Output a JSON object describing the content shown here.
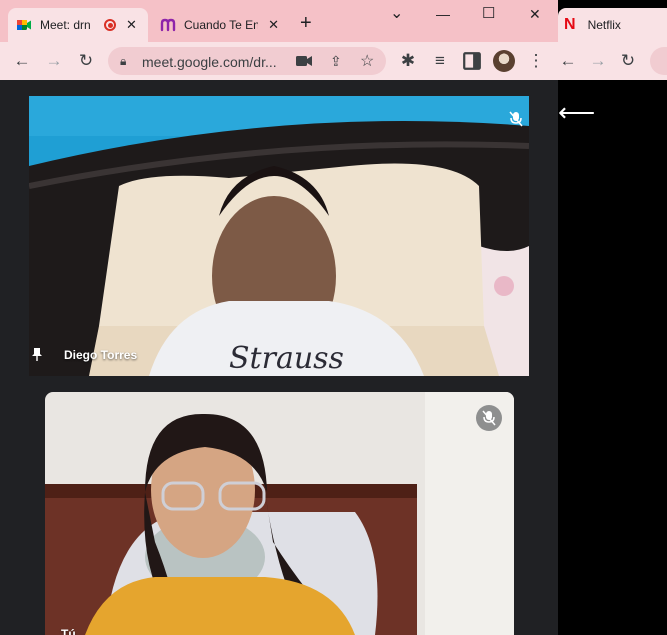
{
  "browser": {
    "tabs": [
      {
        "title": "Meet: drn",
        "recording": true,
        "active": true
      },
      {
        "title": "Cuando Te Enc",
        "active": false
      }
    ],
    "new_tab": "+",
    "url": "meet.google.com/dr...",
    "window_controls": {
      "dropdown": "⌄",
      "minimize": "—",
      "maximize": "☐",
      "close": "✕"
    }
  },
  "meet": {
    "participants": [
      {
        "name": "Diego Torres",
        "muted": true,
        "pinned": true
      },
      {
        "name": "Tú",
        "muted": true
      }
    ]
  },
  "second_window": {
    "tab_title": "Netflix",
    "tab_icon_letter": "N",
    "back_glyph": "⟵"
  },
  "colors": {
    "tabstrip": "#f5c1c7",
    "toolbar": "#f9e2e5",
    "meet_bg": "#202124",
    "netflix_red": "#e50914"
  }
}
